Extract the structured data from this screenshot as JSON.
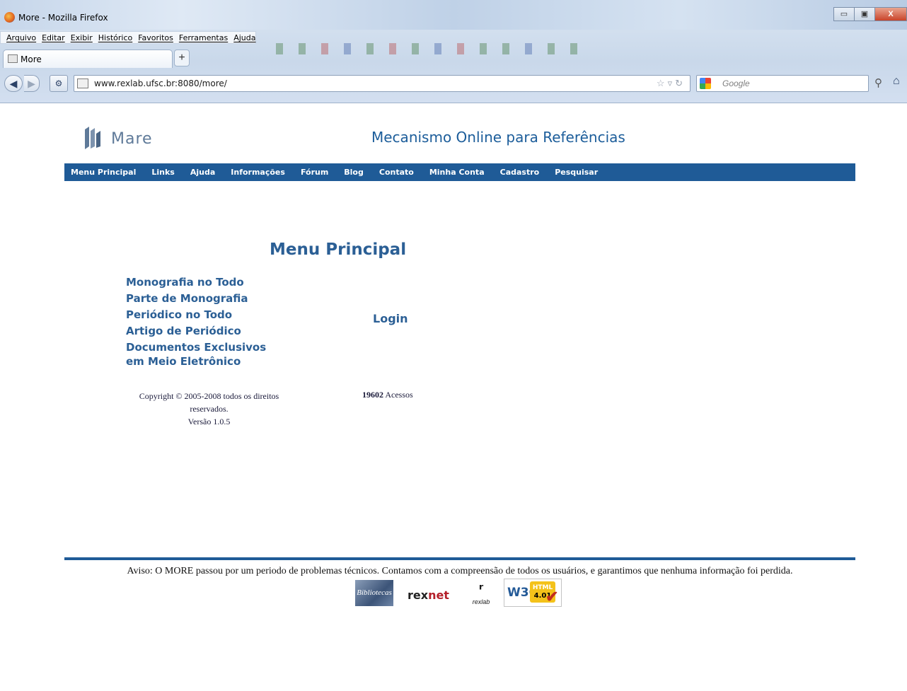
{
  "window": {
    "title": "More - Mozilla Firefox",
    "controls": [
      "minimize-button",
      "maximize-button",
      "close-button"
    ]
  },
  "menubar": {
    "items": [
      "Arquivo",
      "Editar",
      "Exibir",
      "Histórico",
      "Favoritos",
      "Ferramentas",
      "Ajuda"
    ]
  },
  "tab": {
    "label": "More",
    "new_tab": "+"
  },
  "navbar": {
    "url": "www.rexlab.ufsc.br:8080/more/",
    "search_placeholder": "Google"
  },
  "site": {
    "logo_text": "Mare",
    "title": "Mecanismo Online para Referências",
    "nav": [
      "Menu Principal",
      "Links",
      "Ajuda",
      "Informações",
      "Fórum",
      "Blog",
      "Contato",
      "Minha Conta",
      "Cadastro",
      "Pesquisar"
    ]
  },
  "main": {
    "heading": "Menu Principal",
    "menu": [
      "Monografia no Todo",
      "Parte de Monografia",
      "Periódico no Todo",
      "Artigo de Periódico",
      "Documentos Exclusivos",
      "em Meio Eletrônico"
    ],
    "login": "Login",
    "copyright": "Copyright © 2005-2008 todos os direitos reservados.",
    "version": "Versão 1.0.5",
    "access_count": "19602",
    "access_label": "Acessos"
  },
  "footer": {
    "notice": "Aviso: O MORE passou por um periodo de problemas técnicos. Contamos com a compreensão de todos os usuários, e garantimos que nenhuma informação foi perdida.",
    "badges": {
      "bibliotecas": "Bibliotecas",
      "rexnet_a": "rex",
      "rexnet_b": "net",
      "rexlab": "rexlab",
      "w3c": "W3C",
      "html": "HTML",
      "html_version": "4.01"
    }
  },
  "colors": {
    "nav_bar": "#1f5b97",
    "link": "#2b5f95",
    "site_title": "#1c5d9a"
  }
}
